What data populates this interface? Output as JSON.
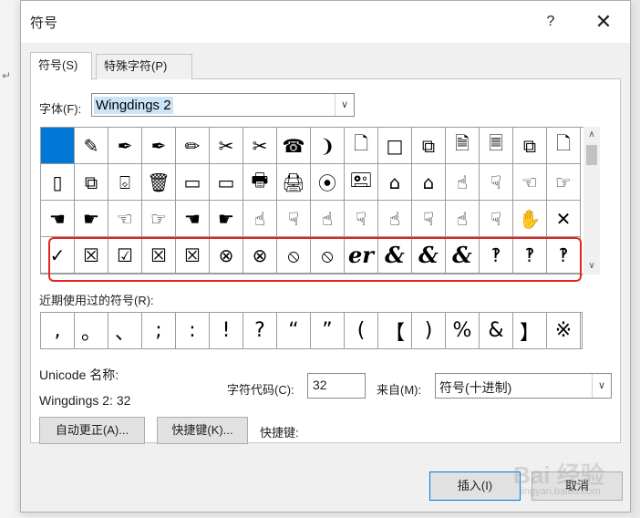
{
  "dialog": {
    "title": "符号",
    "help": "?",
    "close": "✕"
  },
  "stray_mark": "↵",
  "tabs": [
    {
      "label": "符号(S)",
      "active": true
    },
    {
      "label": "特殊字符(P)",
      "active": false
    }
  ],
  "font": {
    "label": "字体(F):",
    "value": "Wingdings 2"
  },
  "symbol_rows": [
    [
      " ",
      "✎",
      "✒",
      "✒",
      "✏",
      "✂",
      "✂",
      "☎",
      "❩",
      "🗋",
      "□",
      "⧉",
      "🗎",
      "🗏",
      "⧉",
      "🗋"
    ],
    [
      "▯",
      "⧉",
      "⌺",
      "🗑",
      "▭",
      "▭",
      "🖶",
      "🖨",
      "⦿",
      "🖭",
      "⌂",
      "⌂",
      "☝",
      "☟",
      "☜",
      "☞"
    ],
    [
      "☚",
      "☛",
      "☜",
      "☞",
      "☚",
      "☛",
      "☝",
      "☟",
      "☝",
      "☟",
      "☝",
      "☟",
      "☝",
      "☟",
      "✋",
      "✕"
    ],
    [
      "✓",
      "☒",
      "☑",
      "☒",
      "☒",
      "⊗",
      "⊗",
      "⦸",
      "⦸",
      "er",
      "&",
      "&",
      "&",
      "‽",
      "‽",
      "‽"
    ]
  ],
  "selected_index": 0,
  "highlight_color": "#e8231e",
  "recent": {
    "label": "近期使用过的符号(R):",
    "symbols": [
      ",",
      "。",
      "、",
      ";",
      ":",
      "!",
      "?",
      "“",
      "”",
      "(",
      "【",
      ")",
      "%",
      "&",
      "】",
      "※"
    ]
  },
  "unicode": {
    "label": "Unicode 名称:",
    "value": "Wingdings 2: 32"
  },
  "char_code": {
    "label": "字符代码(C):",
    "value": "32"
  },
  "from": {
    "label": "来自(M):",
    "value": "符号(十进制)"
  },
  "buttons": {
    "autocorrect": "自动更正(A)...",
    "shortcut_key": "快捷键(K)...",
    "insert": "插入(I)",
    "cancel": "取消"
  },
  "shortcut": {
    "label": "快捷键:"
  },
  "watermark": {
    "text": "Bai 经验",
    "sub": "jingyan.baidu.com"
  }
}
